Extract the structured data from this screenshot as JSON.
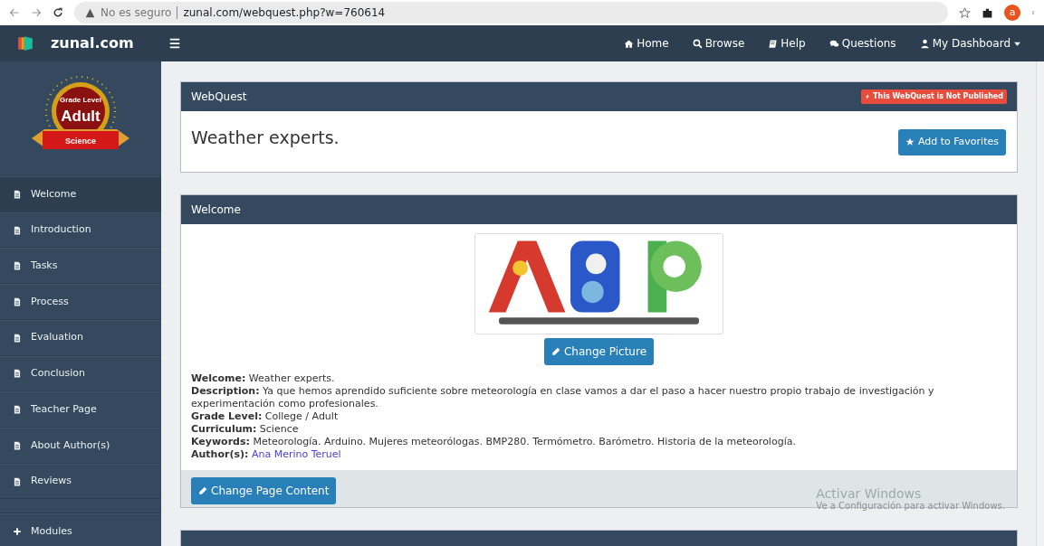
{
  "browser": {
    "security": "No es seguro",
    "url": "zunal.com/webquest.php?w=760614",
    "profile_initial": "a"
  },
  "navbar": {
    "brand": "zunal.com",
    "links": [
      {
        "kind": "home",
        "label": "Home"
      },
      {
        "kind": "search",
        "label": "Browse"
      },
      {
        "kind": "book",
        "label": "Help"
      },
      {
        "kind": "comments",
        "label": "Questions"
      },
      {
        "kind": "user",
        "label": "My Dashboard",
        "dropdown": true
      }
    ]
  },
  "sidebar": {
    "badge": {
      "heading": "Grade Level",
      "level": "Adult",
      "subject": "Science"
    },
    "items": [
      {
        "label": "Welcome",
        "selected": true
      },
      {
        "label": "Introduction",
        "selected": false
      },
      {
        "label": "Tasks",
        "selected": false
      },
      {
        "label": "Process",
        "selected": false
      },
      {
        "label": "Evaluation",
        "selected": false
      },
      {
        "label": "Conclusion",
        "selected": false
      },
      {
        "label": "Teacher Page",
        "selected": false
      },
      {
        "label": "About Author(s)",
        "selected": false
      },
      {
        "label": "Reviews",
        "selected": false
      }
    ],
    "modules": "Modules"
  },
  "webquest_panel": {
    "header": "WebQuest",
    "status": "This WebQuest is Not Published",
    "title": "Weather experts.",
    "favorite_button": "Add to Favorites"
  },
  "welcome_panel": {
    "header": "Welcome",
    "change_picture_button": "Change Picture",
    "details": [
      {
        "text": "**Welcome:** Weather experts."
      },
      {
        "text": "**Description:** Ya que hemos aprendido suficiente sobre meteorología en clase vamos a dar el paso a hacer nuestro propio trabajo de investigación y experimentación como profesionales."
      },
      {
        "text": "**Grade Level:** College / Adult"
      },
      {
        "text": "**Curriculum:** Science"
      },
      {
        "text": "**Keywords:** Meteorología. Arduino. Mujeres meteorólogas. BMP280. Termómetro. Barómetro. Historia de la meteorología."
      },
      {
        "label": "Author(s):",
        "value": "Ana Merino Teruel",
        "kind": "link"
      }
    ],
    "change_content_button": "Change Page Content"
  },
  "os_notice": {
    "title": "Activar Windows",
    "subtitle": "Ve a Configuración para activar Windows."
  }
}
